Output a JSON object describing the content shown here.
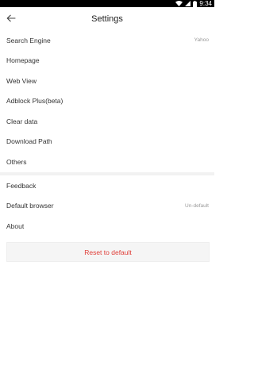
{
  "status_bar": {
    "time": "9:34",
    "icons": [
      "wifi-icon",
      "signal-icon",
      "battery-icon"
    ]
  },
  "toolbar": {
    "back_icon": "arrow-left-icon",
    "title": "Settings"
  },
  "settings_group_1": [
    {
      "label": "Search Engine",
      "value": "Yahoo"
    },
    {
      "label": "Homepage",
      "value": ""
    },
    {
      "label": "Web View",
      "value": ""
    },
    {
      "label": "Adblock Plus(beta)",
      "value": ""
    },
    {
      "label": "Clear data",
      "value": ""
    },
    {
      "label": "Download Path",
      "value": ""
    },
    {
      "label": "Others",
      "value": ""
    }
  ],
  "settings_group_2": [
    {
      "label": "Feedback",
      "value": ""
    },
    {
      "label": "Default browser",
      "value": "Un-default"
    },
    {
      "label": "About",
      "value": ""
    }
  ],
  "reset": {
    "label": "Reset to default"
  },
  "colors": {
    "accent_red": "#e0403a",
    "section_gap": "#f2f2f2",
    "text_primary": "#333333",
    "text_secondary": "#999999"
  }
}
